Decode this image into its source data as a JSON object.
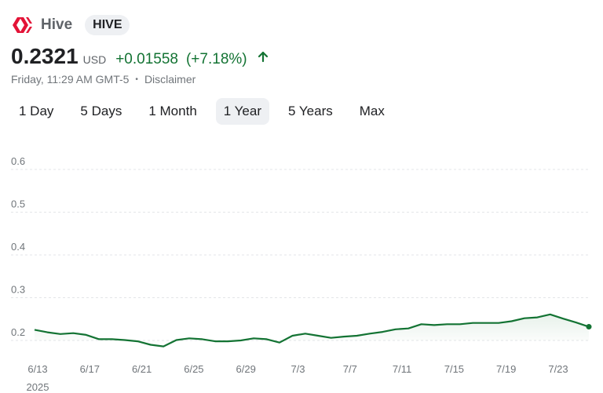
{
  "header": {
    "name": "Hive",
    "ticker": "HIVE",
    "logo_icon": "hive-logo-icon",
    "brand_color": "#e31337"
  },
  "quote": {
    "price": "0.2321",
    "currency": "USD",
    "change": "+0.01558",
    "change_pct": "(+7.18%)",
    "change_color": "#137333",
    "arrow_icon": "arrow-up-icon"
  },
  "meta": {
    "timestamp": "Friday, 11:29 AM GMT-5",
    "separator": "•",
    "disclaimer": "Disclaimer"
  },
  "tabs": [
    {
      "label": "1 Day",
      "active": false
    },
    {
      "label": "5 Days",
      "active": false
    },
    {
      "label": "1 Month",
      "active": false
    },
    {
      "label": "1 Year",
      "active": true
    },
    {
      "label": "5 Years",
      "active": false
    },
    {
      "label": "Max",
      "active": false
    }
  ],
  "chart_data": {
    "type": "area",
    "title": "",
    "xlabel": "",
    "ylabel": "",
    "ylim": [
      0.18,
      0.62
    ],
    "yticks": [
      "0.6",
      "0.5",
      "0.4",
      "0.3",
      "0.2"
    ],
    "ytick_values": [
      0.6,
      0.5,
      0.4,
      0.3,
      0.2
    ],
    "xticks": [
      "6/13",
      "6/17",
      "6/21",
      "6/25",
      "6/29",
      "7/3",
      "7/7",
      "7/11",
      "7/15",
      "7/19",
      "7/23"
    ],
    "xtick_sub": "2025",
    "grid": true,
    "line_color": "#137333",
    "series": [
      {
        "values": [
          0.225,
          0.219,
          0.215,
          0.217,
          0.213,
          0.203,
          0.203,
          0.201,
          0.198,
          0.19,
          0.186,
          0.201,
          0.205,
          0.203,
          0.198,
          0.198,
          0.2,
          0.205,
          0.203,
          0.195,
          0.211,
          0.216,
          0.211,
          0.206,
          0.209,
          0.211,
          0.216,
          0.22,
          0.226,
          0.228,
          0.238,
          0.236,
          0.238,
          0.238,
          0.241,
          0.241,
          0.241,
          0.245,
          0.252,
          0.254,
          0.261,
          0.251,
          0.242,
          0.232
        ]
      }
    ]
  }
}
